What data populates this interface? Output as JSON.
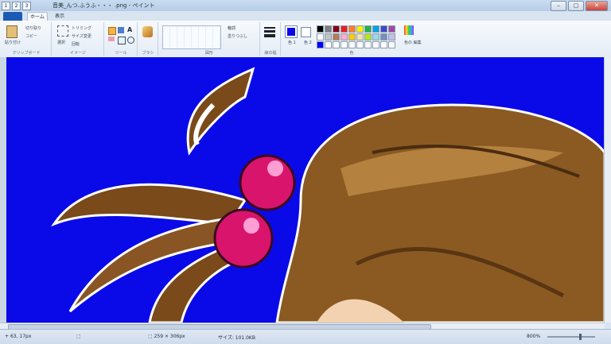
{
  "window": {
    "title": "音美_んつ.ふうふ・・・ .png - ペイント",
    "qat": [
      "1",
      "2",
      "3"
    ],
    "buttons": [
      "–",
      "▢",
      "✕"
    ]
  },
  "tabs": {
    "file": "",
    "home": "ホーム",
    "view": "表示"
  },
  "ribbon": {
    "clipboard": {
      "paste": "貼り付け",
      "cut": "切り取り",
      "copy": "コピー",
      "label": "クリップボード"
    },
    "image": {
      "select": "選択",
      "crop": "トリミング",
      "resize": "サイズ変更",
      "rotate": "回転",
      "label": "イメージ"
    },
    "tools": {
      "label": "ツール"
    },
    "brushes": {
      "label": "ブラシ"
    },
    "shapes": {
      "outline": "輪郭",
      "fill": "塗りつぶし",
      "label": "図形"
    },
    "size": {
      "label": "線の幅"
    },
    "colors": {
      "color1": "色\n1",
      "color2": "色\n2",
      "edit": "色の\n編集",
      "label": "色",
      "color1_value": "#0a0ae8",
      "color2_value": "#ffffff",
      "palette": [
        "#000000",
        "#7f7f7f",
        "#880015",
        "#ed1c24",
        "#ff7f27",
        "#fff200",
        "#22b14c",
        "#00a2e8",
        "#3f48cc",
        "#a349a4",
        "#ffffff",
        "#c3c3c3",
        "#b97a57",
        "#ffaec9",
        "#ffc90e",
        "#efe4b0",
        "#b5e61d",
        "#99d9ea",
        "#7092be",
        "#c8bfe7",
        "#0000ff",
        "#ffffff",
        "#ffffff",
        "#ffffff",
        "#ffffff",
        "#ffffff",
        "#ffffff",
        "#ffffff",
        "#ffffff",
        "#ffffff"
      ]
    }
  },
  "status": {
    "cursor": "63, 17px",
    "selection": "",
    "dimensions": "259 × 306px",
    "size": "サイズ: 101.0KB",
    "zoom": "800%"
  }
}
